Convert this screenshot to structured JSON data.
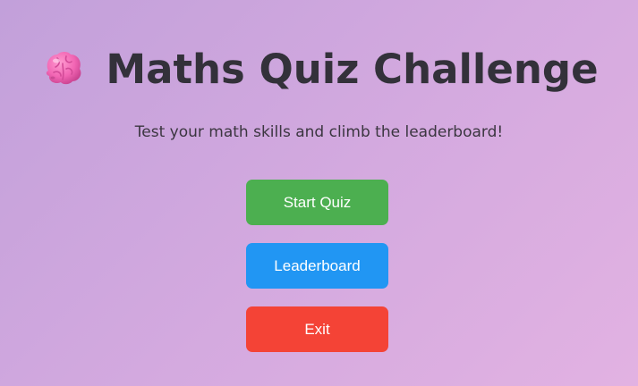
{
  "header": {
    "title": "Maths Quiz Challenge",
    "icon": "brain-icon",
    "subtitle": "Test your math skills and climb the leaderboard!"
  },
  "menu": {
    "start_label": "Start Quiz",
    "leaderboard_label": "Leaderboard",
    "exit_label": "Exit"
  },
  "colors": {
    "start": "#4caf50",
    "leaderboard": "#2196f3",
    "exit": "#f44336",
    "title": "#33313a"
  }
}
